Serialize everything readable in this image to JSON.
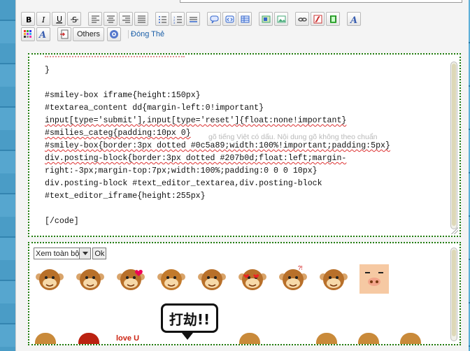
{
  "toolbar": {
    "row1": [
      {
        "name": "bold-button",
        "icon": "bold-icon",
        "glyph": "B"
      },
      {
        "name": "italic-button",
        "icon": "italic-icon",
        "glyph": "I"
      },
      {
        "name": "underline-button",
        "icon": "underline-icon",
        "glyph": "U"
      },
      {
        "name": "strikethrough-button",
        "icon": "strikethrough-icon",
        "glyph": "S"
      },
      {
        "name": "align-left-button",
        "icon": "align-left-icon",
        "glyph": ""
      },
      {
        "name": "align-center-button",
        "icon": "align-center-icon",
        "glyph": ""
      },
      {
        "name": "align-right-button",
        "icon": "align-right-icon",
        "glyph": ""
      },
      {
        "name": "align-justify-button",
        "icon": "align-justify-icon",
        "glyph": ""
      },
      {
        "name": "bullet-list-button",
        "icon": "bullet-list-icon",
        "glyph": ""
      },
      {
        "name": "numbered-list-button",
        "icon": "numbered-list-icon",
        "glyph": ""
      },
      {
        "name": "horizontal-rule-button",
        "icon": "horizontal-rule-icon",
        "glyph": ""
      },
      {
        "name": "quote-button",
        "icon": "speech-bubble-icon",
        "glyph": ""
      },
      {
        "name": "code-button",
        "icon": "code-icon",
        "glyph": ""
      },
      {
        "name": "table-button",
        "icon": "table-icon",
        "glyph": ""
      },
      {
        "name": "image-button",
        "icon": "image-icon",
        "glyph": ""
      },
      {
        "name": "image-upload-button",
        "icon": "picture-icon",
        "glyph": ""
      },
      {
        "name": "link-button",
        "icon": "link-icon",
        "glyph": ""
      },
      {
        "name": "flash-button",
        "icon": "flash-icon",
        "glyph": ""
      },
      {
        "name": "video-button",
        "icon": "film-icon",
        "glyph": ""
      },
      {
        "name": "font-button",
        "icon": "font-icon",
        "glyph": "A"
      }
    ],
    "others_label": "Others",
    "close_label": "Đóng Thẻ"
  },
  "editor": {
    "hint_text": "gõ tiếng Việt có dấu. Nội dung gõ không theo chuẩn",
    "hint_text_2": "Nội dung gõ không theo chuẩn",
    "code_lines": [
      "}",
      "",
      "#smiley-box iframe{height:150px}",
      "#textarea_content dd{margin-left:0!important}",
      "input[type='submit'],input[type='reset']{float:none!important}",
      "#smilies_categ{padding:10px 0}",
      "#smiley-box{border:3px dotted #0c5a89;width:100%!important;padding:5px}",
      "div.posting-block{border:3px dotted #207b0d;float:left;margin-",
      "right:-3px;margin-top:7px;width:100%;padding:0 0 0 10px}",
      "div.posting-block #text_editor_textarea,div.posting-block",
      "#text_editor_iframe{height:255px}",
      "",
      "[/code]"
    ]
  },
  "smilies": {
    "category_selected": "Xem toàn bộ",
    "ok_label": "Ok",
    "banner_text": "打劫!!",
    "love_text": "love U",
    "items": [
      "monkey-wave",
      "monkey-shy",
      "monkey-heart",
      "monkey-happy",
      "monkey-grin",
      "monkey-love",
      "monkey-surprised",
      "monkey-cry",
      "pig-face"
    ]
  }
}
